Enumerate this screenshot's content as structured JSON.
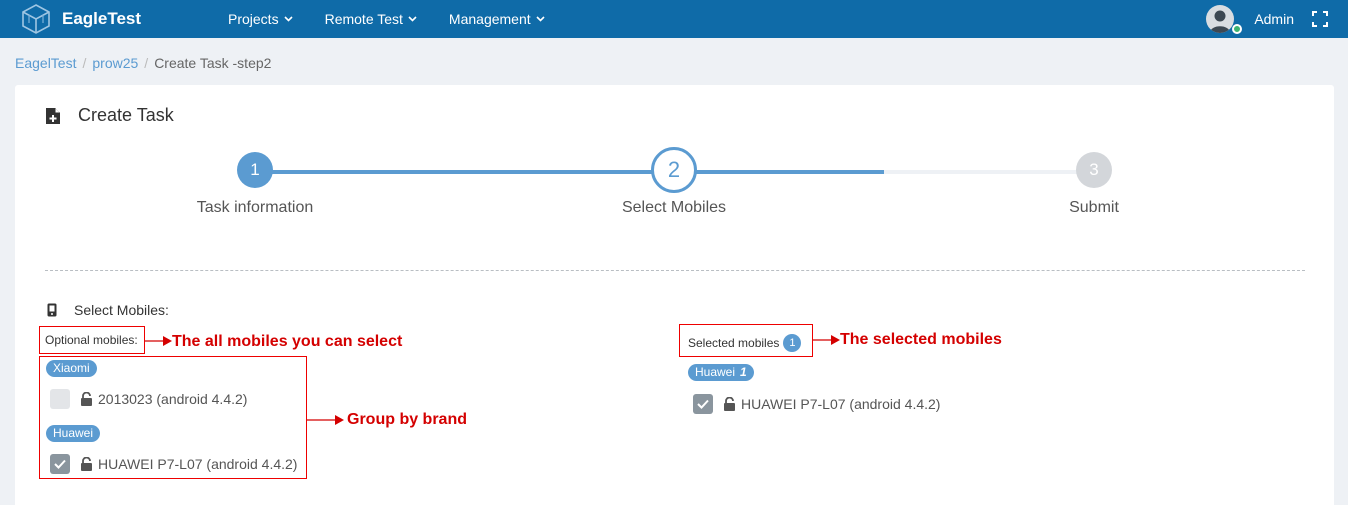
{
  "app": {
    "name": "EagleTest",
    "logo_icon": "cube-logo-icon"
  },
  "nav": {
    "items": [
      {
        "label": "Projects"
      },
      {
        "label": "Remote Test"
      },
      {
        "label": "Management"
      }
    ]
  },
  "user": {
    "name": "Admin",
    "status_color": "#3cb371"
  },
  "breadcrumb": {
    "items": [
      "EagelTest",
      "prow25"
    ],
    "current": "Create Task -step2"
  },
  "panel": {
    "title": "Create Task"
  },
  "steps": [
    {
      "number": "1",
      "label": "Task information",
      "state": "done"
    },
    {
      "number": "2",
      "label": "Select Mobiles",
      "state": "active"
    },
    {
      "number": "3",
      "label": "Submit",
      "state": "todo"
    }
  ],
  "section": {
    "title": "Select Mobiles:"
  },
  "optional": {
    "label": "Optional mobiles:",
    "groups": [
      {
        "brand": "Xiaomi",
        "devices": [
          {
            "name": "2013023 (android 4.4.2)",
            "checked": false
          }
        ]
      },
      {
        "brand": "Huawei",
        "devices": [
          {
            "name": "HUAWEI P7-L07 (android 4.4.2)",
            "checked": true
          }
        ]
      }
    ]
  },
  "selected": {
    "label": "Selected mobiles",
    "count": "1",
    "groups": [
      {
        "brand": "Huawei",
        "count": "1",
        "devices": [
          {
            "name": "HUAWEI P7-L07 (android 4.4.2)",
            "checked": true
          }
        ]
      }
    ]
  },
  "annotations": {
    "optional": "The all mobiles you can select",
    "group": "Group by brand",
    "selected": "The selected mobiles"
  },
  "colors": {
    "topbar": "#0f6ba8",
    "accent": "#5b9bd1",
    "annotation": "#d40000"
  }
}
